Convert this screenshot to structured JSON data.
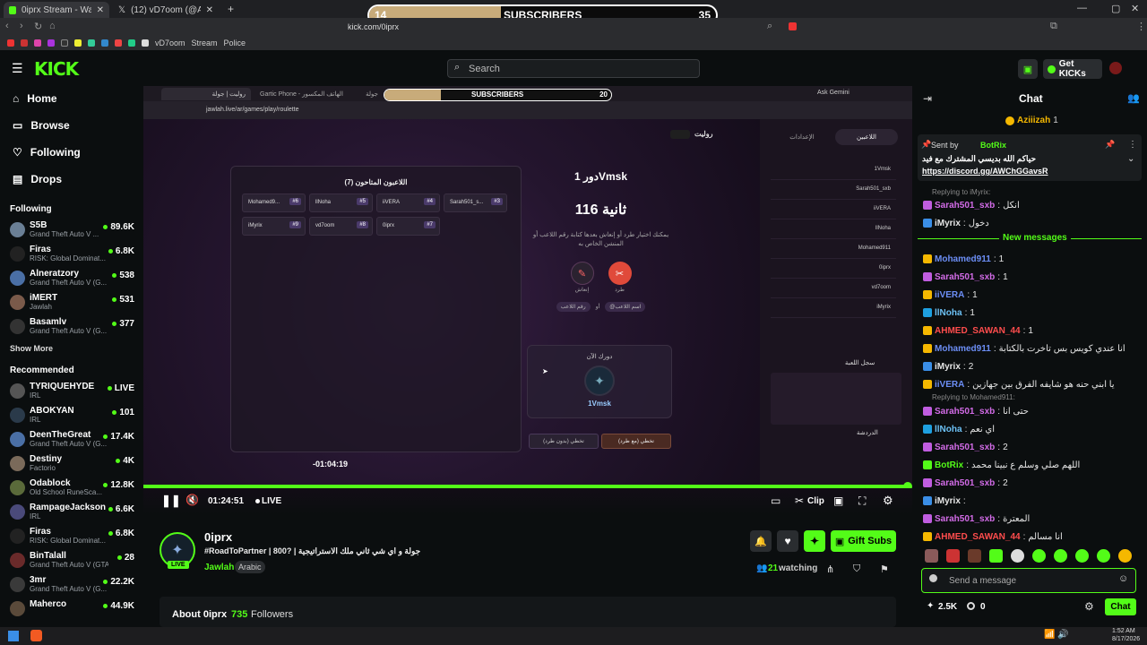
{
  "browser": {
    "tabs": [
      {
        "title": "0iprx Stream - Watch Live on Kick"
      },
      {
        "title": "(12) vD7oom (@Abuda7maa) / X"
      }
    ],
    "url": "kick.com/0iprx",
    "bookmarks": [
      "vD7oom",
      "Stream",
      "Police"
    ]
  },
  "overlay": {
    "left_count": "14",
    "label": "SUBSCRIBERS",
    "right_count": "35"
  },
  "header": {
    "search_placeholder": "Search",
    "get_kicks": "Get KICKs"
  },
  "sidebar": {
    "nav": [
      {
        "label": "Home"
      },
      {
        "label": "Browse"
      },
      {
        "label": "Following"
      },
      {
        "label": "Drops"
      }
    ],
    "following_title": "Following",
    "following": [
      {
        "name": "S5B",
        "game": "Grand Theft Auto V ...",
        "viewers": "89.6K",
        "color": "#6a7f95"
      },
      {
        "name": "Firas",
        "game": "RISK: Global Dominat...",
        "viewers": "6.8K",
        "color": "#222"
      },
      {
        "name": "Alneratzory",
        "game": "Grand Theft Auto V (G...",
        "viewers": "538",
        "color": "#4a6fa5"
      },
      {
        "name": "iMERT",
        "game": "Jawlah",
        "viewers": "531",
        "color": "#7a5a4a"
      },
      {
        "name": "Basamlv",
        "game": "Grand Theft Auto V (G...",
        "viewers": "377",
        "color": "#333"
      }
    ],
    "show_more": "Show More",
    "recommended_title": "Recommended",
    "recommended": [
      {
        "name": "TYRIQUEHYDE",
        "game": "IRL",
        "viewers": "LIVE",
        "color": "#555"
      },
      {
        "name": "ABOKYAN",
        "game": "IRL",
        "viewers": "101",
        "color": "#2a3a4a"
      },
      {
        "name": "DeenTheGreat",
        "game": "Grand Theft Auto V (G...",
        "viewers": "17.4K",
        "color": "#4a6fa5"
      },
      {
        "name": "Destiny",
        "game": "Factorio",
        "viewers": "4K",
        "color": "#7a6a5a"
      },
      {
        "name": "Odablock",
        "game": "Old School RuneSca...",
        "viewers": "12.8K",
        "color": "#5a6a3a"
      },
      {
        "name": "RampageJackson",
        "game": "IRL",
        "viewers": "6.6K",
        "color": "#4a4a7a"
      },
      {
        "name": "Firas",
        "game": "RISK: Global Dominat...",
        "viewers": "6.8K",
        "color": "#222"
      },
      {
        "name": "BinTalall",
        "game": "Grand Theft Auto V (GTA)",
        "viewers": "28",
        "color": "#6a2a2a"
      },
      {
        "name": "3mr",
        "game": "Grand Theft Auto V (G...",
        "viewers": "22.2K",
        "color": "#3a3a3a"
      },
      {
        "name": "Maherco",
        "game": "",
        "viewers": "44.9K",
        "color": "#5a4a3a"
      }
    ]
  },
  "player": {
    "inner_tabs": [
      "روليت | جولة",
      "Gartic Phone - الهاتف المكسور",
      "جولة"
    ],
    "inner_url": "jawlah.live/ar/games/play/roulette",
    "ask_gemini": "Ask Gemini",
    "inner_overlay_label": "SUBSCRIBERS",
    "inner_overlay_right": "20",
    "game": {
      "panel_title": "اللاعبون المتاحون (7)",
      "players": [
        {
          "name": "Mohamed9...",
          "num": "#6"
        },
        {
          "name": "llNoha",
          "num": "#5"
        },
        {
          "name": "iiVERA",
          "num": "#4"
        },
        {
          "name": "Sarah501_s...",
          "num": "#3"
        },
        {
          "name": "iMyrix",
          "num": "#9"
        },
        {
          "name": "vd7oom",
          "num": "#8"
        },
        {
          "name": "0iprx",
          "num": "#7"
        }
      ],
      "turn_title": "دور 1Vmsk",
      "timer": "116 ثانية",
      "instructions": "يمكنك اختيار طرد أو إنعاش بعدها كتابة رقم اللاعب أو المنشن الخاص به",
      "revive_label": "إنعاش",
      "kick_label": "طرد",
      "pill_a": "رقم اللاعب",
      "pill_or": "أو",
      "pill_b": "@اسم اللاعب",
      "your_turn": "دورك الآن",
      "player_name": "1Vmsk",
      "skip_a": "تخطي (بدون طرد)",
      "skip_b": "تخطي (مع طرد)",
      "roulette_label": "روليت",
      "settings_tab": "الإعدادات",
      "players_tab": "اللاعبين",
      "right_list": [
        "1Vmsk",
        "Sarah501_sxb",
        "iiVERA",
        "llNoha",
        "Mohamed911",
        "0iprx",
        "vd7oom",
        "iMyrix"
      ],
      "log_title": "سجل اللعبة",
      "chat_title": "الدردشة"
    },
    "timeline_time": "-01:04:19",
    "progress": 0.995,
    "time": "01:24:51",
    "live": "LIVE",
    "clip": "Clip"
  },
  "stream": {
    "channel": "0iprx",
    "title": "#RoadToPartner | 800? | جولة و اي شي ثاني ملك الاستراتيجية",
    "category": "Jawlah",
    "language": "Arabic",
    "live_badge": "LIVE",
    "gift_subs": "Gift Subs",
    "watching_count": "21",
    "watching_label": "watching",
    "about": "About 0iprx",
    "followers_count": "735",
    "followers_label": "Followers"
  },
  "chat": {
    "title": "Chat",
    "top_user": "Aziiizah",
    "top_count": "1",
    "pinned_by": "Sent by",
    "pinned_user": "BotRix",
    "pinned_text": "حياكم الله بديسي المشترك مع فيد",
    "pinned_link": "https://discord.gg/AWChGGavsR",
    "replying1": "Replying to iMyrix:",
    "replying2": "Replying to Mohamed911:",
    "new_messages": "New messages",
    "messages": [
      {
        "user": "Sarah501_sxb",
        "text": "انكل",
        "color": "#d36ce8"
      },
      {
        "user": "iMyrix",
        "text": "دخول",
        "color": "#e6e6e6"
      },
      {
        "user": "Mohamed911",
        "text": "1",
        "color": "#6c8ef5"
      },
      {
        "user": "Sarah501_sxb",
        "text": "1",
        "color": "#d36ce8"
      },
      {
        "user": "iiVERA",
        "text": "1",
        "color": "#6c8ef5"
      },
      {
        "user": "llNoha",
        "text": "1",
        "color": "#6cc1f5"
      },
      {
        "user": "AHMED_SAWAN_44",
        "text": "1",
        "color": "#ff4d4d"
      },
      {
        "user": "Mohamed911",
        "text": "انا عندي كويس بس تاخرت بالكتابة",
        "color": "#6c8ef5"
      },
      {
        "user": "iMyrix",
        "text": "2",
        "color": "#e6e6e6"
      },
      {
        "user": "iiVERA",
        "text": "يا ابني حنه هو شايفه الفرق بين جهازين",
        "color": "#6c8ef5"
      },
      {
        "user": "Sarah501_sxb",
        "text": "حتى انا",
        "color": "#d36ce8"
      },
      {
        "user": "llNoha",
        "text": "اي نعم",
        "color": "#6cc1f5"
      },
      {
        "user": "Sarah501_sxb",
        "text": "2",
        "color": "#d36ce8"
      },
      {
        "user": "BotRix",
        "text": "اللهم صلي وسلم ع نبينا محمد",
        "color": "#53fc18"
      },
      {
        "user": "Sarah501_sxb",
        "text": "2",
        "color": "#d36ce8"
      },
      {
        "user": "iMyrix",
        "text": "",
        "color": "#e6e6e6"
      },
      {
        "user": "Sarah501_sxb",
        "text": "المعترة",
        "color": "#d36ce8"
      },
      {
        "user": "AHMED_SAWAN_44",
        "text": "انا مسالم",
        "color": "#ff4d4d"
      }
    ],
    "input_placeholder": "Send a message",
    "kicks": "2.5K",
    "points": "0",
    "send": "Chat"
  },
  "taskbar": {
    "time": "1:52 AM",
    "date": "8/17/2026"
  },
  "colors": {
    "kick_green": "#53fc18",
    "bg": "#0b0e0f"
  }
}
